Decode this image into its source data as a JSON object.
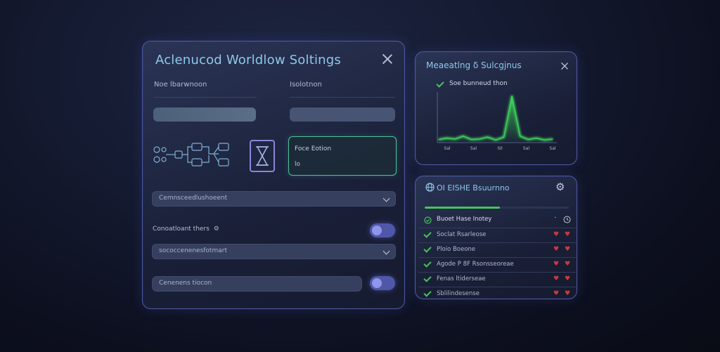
{
  "settings": {
    "title": "Aclenucod Worldlow Soltings",
    "col1_label": "Noe lbarwnoon",
    "col2_label": "Isolotnon",
    "focus_card": {
      "title": "Foce Eotion",
      "sub": "lo"
    },
    "dropdown1": "Cemnsceedlushoeent",
    "toggle1_label": "Conoatloant thers",
    "dropdown2": "sococcenenesfotmart",
    "input_field": "Cenenens tiocon"
  },
  "monitor": {
    "title": "Meaeatlng ẟ Sulcgjnus",
    "legend": "Soe bunneud thon",
    "chart_data": {
      "type": "area",
      "categories": [
        "Sal",
        "Sal",
        "SIl",
        "Sal",
        "Sal"
      ],
      "values": [
        0.05,
        0.08,
        0.06,
        0.12,
        0.05,
        0.06,
        0.1,
        0.04,
        0.1,
        0.95,
        0.12,
        0.05,
        0.08,
        0.04,
        0.06
      ],
      "title": "",
      "xlabel": "",
      "ylabel": "",
      "color": "#3ed45a"
    }
  },
  "status": {
    "title": "OI EISHE Bsuurnno",
    "progress": 0.52,
    "header": "Buoet Hase Inotey",
    "rows": [
      "Soclat Rsarleose",
      "Ploio Boeone",
      "Agode P 8F Rsonsseoreae",
      "Fenas ltiderseae",
      "Sblilindesense"
    ]
  },
  "colors": {
    "accent": "#8fc8ea",
    "success": "#45c35c",
    "danger": "#c93a3a",
    "toggle": "#5057a8",
    "panel_border": "#4c57a8"
  }
}
